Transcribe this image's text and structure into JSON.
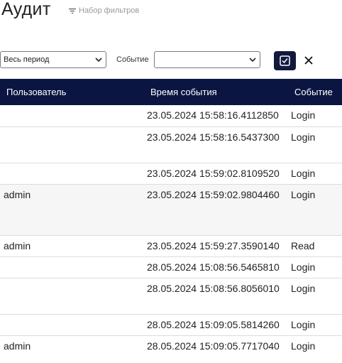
{
  "page": {
    "title": "Аудит",
    "filter_set_label": "Набор фильтров"
  },
  "toolbar": {
    "period_value": "Весь период",
    "event_label": "Событие",
    "event_value": ""
  },
  "table": {
    "columns": [
      "Пользователь",
      "Время события",
      "Событие"
    ],
    "rows": [
      {
        "user": "",
        "time": "23.05.2024 15:58:16.4112850",
        "event": "Login"
      },
      {
        "user": "",
        "time": "23.05.2024 15:58:16.5437300",
        "event": "Login"
      },
      {
        "user": "",
        "time": "23.05.2024 15:59:02.8109520",
        "event": "Login"
      },
      {
        "user": "admin",
        "time": "23.05.2024 15:59:02.9804460",
        "event": "Login"
      },
      {
        "user": "admin",
        "time": "23.05.2024 15:59:27.3590140",
        "event": "Read"
      },
      {
        "user": "",
        "time": "28.05.2024 15:08:56.5465810",
        "event": "Login"
      },
      {
        "user": "",
        "time": "28.05.2024 15:08:56.8056010",
        "event": "Login"
      },
      {
        "user": "",
        "time": "28.05.2024 15:09:05.5814260",
        "event": "Login"
      },
      {
        "user": "admin",
        "time": "28.05.2024 15:09:05.7717040",
        "event": "Login"
      }
    ]
  },
  "colors": {
    "header_bg": "#0a1641",
    "accent_button": "#111a3d"
  },
  "icons": {
    "filter": "filter-icon",
    "apply": "check-square-icon",
    "clear": "close-icon",
    "dropdown": "chevron-down-icon"
  }
}
